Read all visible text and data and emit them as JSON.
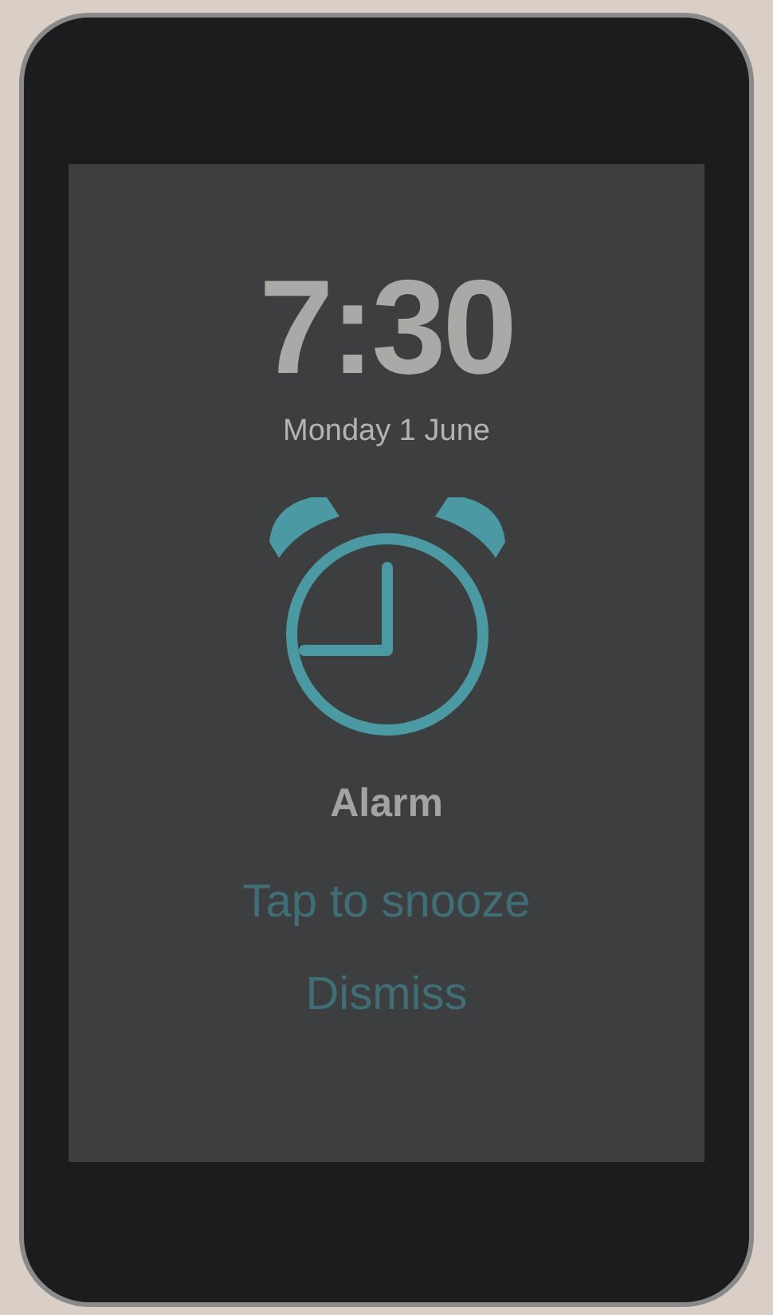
{
  "alarm_screen": {
    "time": "7:30",
    "date": "Monday 1 June",
    "label": "Alarm",
    "actions": [
      "Tap to snooze",
      "Dismiss"
    ]
  }
}
